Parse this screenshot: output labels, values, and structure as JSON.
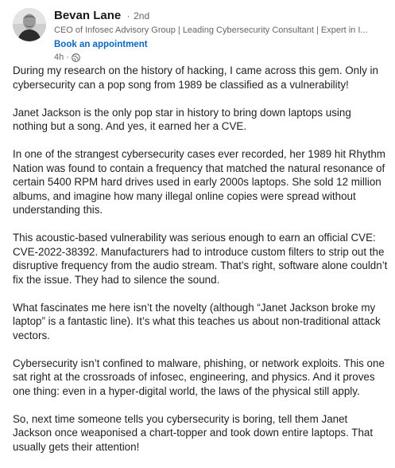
{
  "author": {
    "name": "Bevan Lane",
    "separator": "·",
    "degree": "2nd",
    "headline": "CEO of Infosec Advisory Group | Leading Cybersecurity Consultant | Expert in I...",
    "cta_label": "Book an appointment",
    "time": "4h",
    "time_separator": "·",
    "visibility_icon": "globe-icon"
  },
  "post": {
    "paragraphs": [
      "During my research on the history of hacking, I came across this gem. Only in cybersecurity can a pop song from 1989 be classified as a vulnerability!",
      "Janet Jackson is the only pop star in history to bring down laptops using nothing but a song. And yes, it earned her a CVE.",
      "In one of the strangest cybersecurity cases ever recorded, her 1989 hit Rhythm Nation was found to contain a frequency that matched the natural resonance of certain 5400 RPM hard drives used in early 2000s laptops. She sold 12 million albums, and imagine how many illegal online copies were spread without understanding this.",
      "This acoustic-based vulnerability was serious enough to earn an official CVE: CVE-2022-38392. Manufacturers had to introduce custom filters to strip out the disruptive frequency from the audio stream. That’s right, software alone couldn’t fix the issue. They had to silence the sound.",
      "What fascinates me here isn’t the novelty (although “Janet Jackson broke my laptop” is a fantastic line). It’s what this teaches us about non-traditional attack vectors.",
      "Cybersecurity isn’t confined to malware, phishing, or network exploits. This one sat right at the crossroads of infosec, engineering, and physics. And it proves one thing: even in a hyper-digital world, the laws of the physical still apply.",
      "So, next time someone tells you cybersecurity is boring, tell them Janet Jackson once weaponised a chart-topper and took down entire laptops. That usually gets their attention!"
    ]
  },
  "colors": {
    "link": "#0a66c2",
    "secondary_text": "#666666",
    "primary_text": "#1f1f1f"
  }
}
